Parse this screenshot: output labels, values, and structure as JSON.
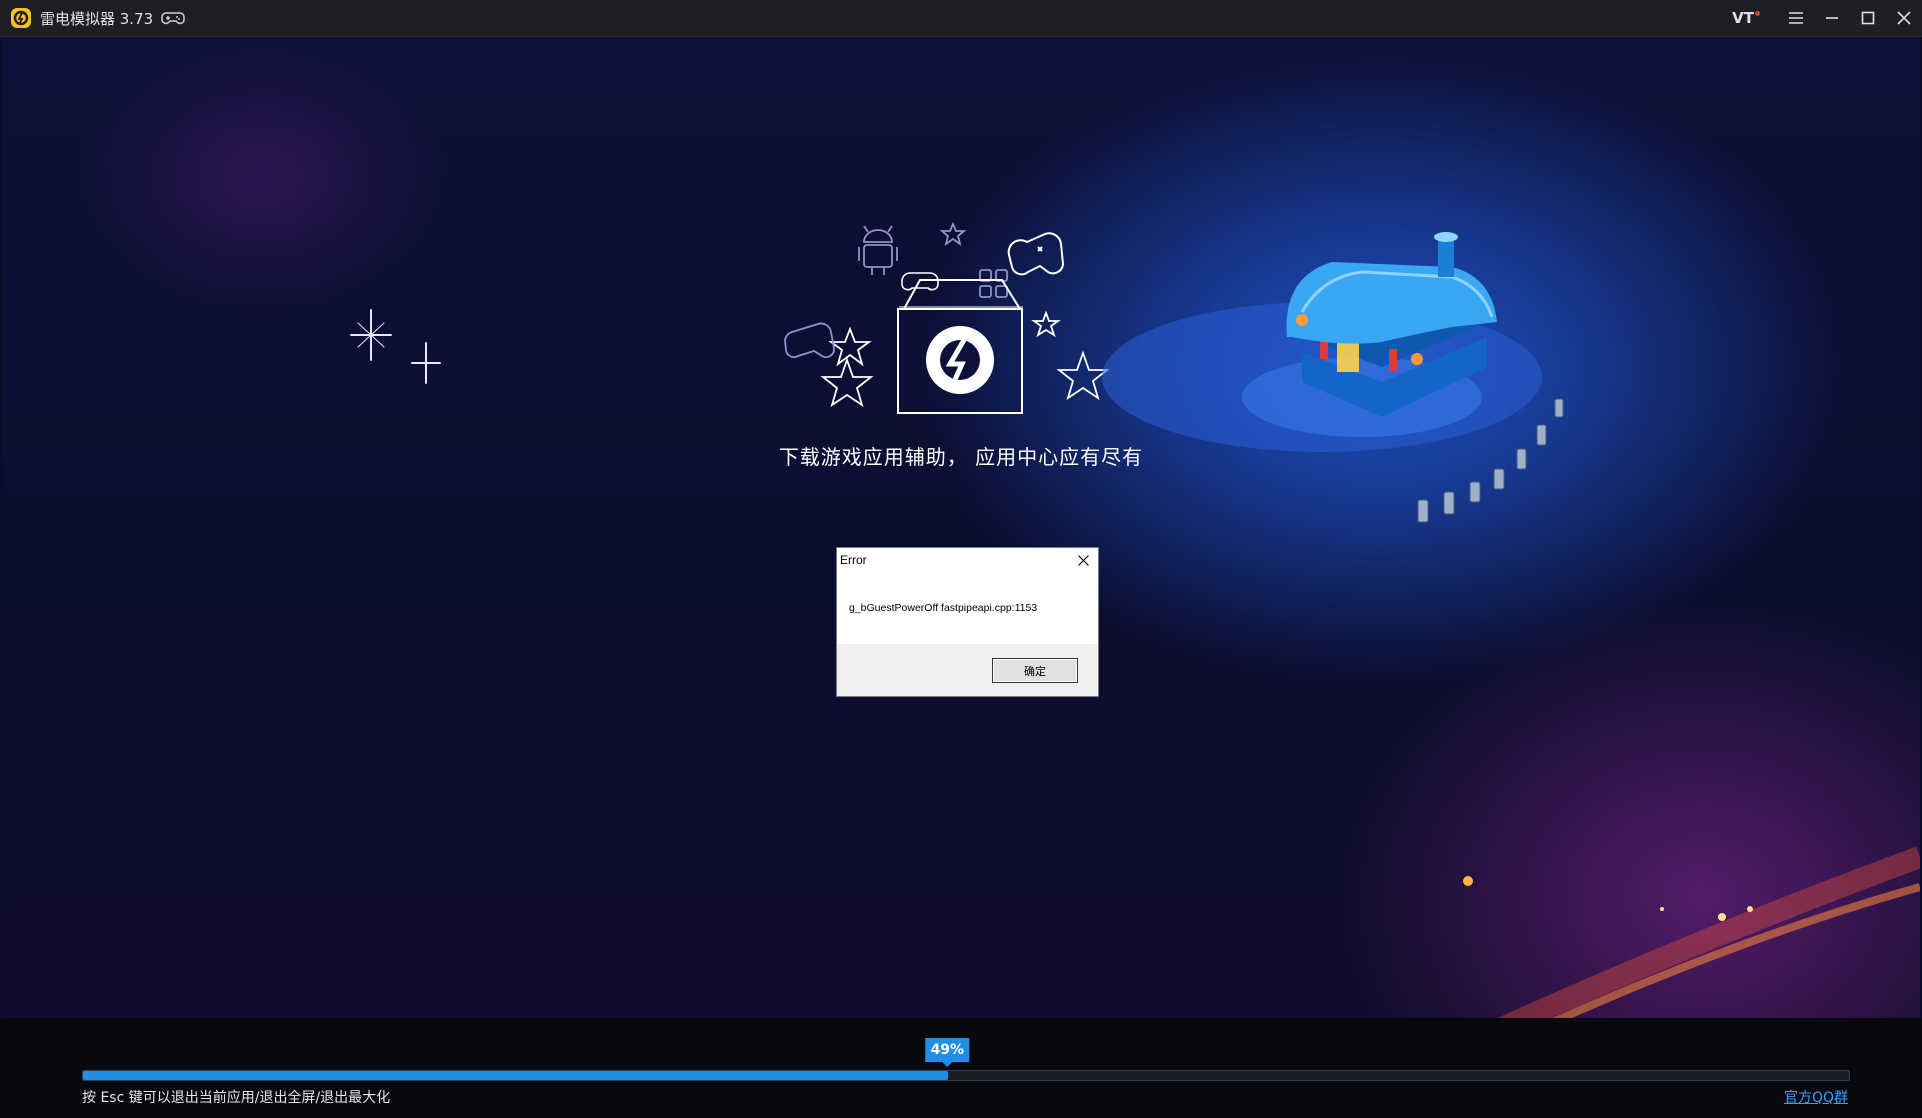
{
  "window": {
    "title": "雷电模拟器 3.73",
    "vt_label": "VT"
  },
  "main": {
    "tagline": "下载游戏应用辅助， 应用中心应有尽有"
  },
  "dialog": {
    "title": "Error",
    "message": "g_bGuestPowerOff fastpipeapi.cpp:1153",
    "ok_label": "确定"
  },
  "bottom": {
    "progress": 49,
    "progress_label": "49%",
    "hint": "按 Esc 键可以退出当前应用/退出全屏/退出最大化",
    "qq_link": "官方QQ群"
  },
  "colors": {
    "accent": "#1e8ee6",
    "titlebar": "#1e1f23",
    "link": "#3aa0ff"
  },
  "icons": {
    "app_logo": "leidian-logo",
    "gamepad": "gamepad-icon",
    "menu": "menu-icon",
    "minimize": "minimize-icon",
    "maximize": "maximize-icon",
    "close": "close-icon"
  }
}
